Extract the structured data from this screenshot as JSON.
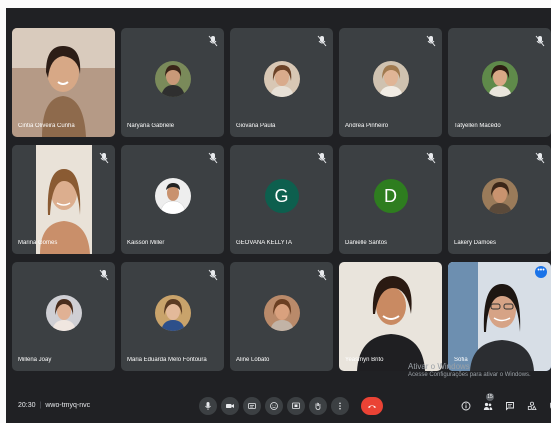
{
  "participants": [
    {
      "name": "Cintia Oliveira Cunha"
    },
    {
      "name": "Naryana Gabriele"
    },
    {
      "name": "Giovana Paula"
    },
    {
      "name": "Andrea Pinheiro"
    },
    {
      "name": "Tatyellen Macêdo"
    },
    {
      "name": "Marina Gomes"
    },
    {
      "name": "Kaisson Miller"
    },
    {
      "name": "GEOVANA KELLYTA",
      "initial": "G"
    },
    {
      "name": "Danielle Santos",
      "initial": "D"
    },
    {
      "name": "Lakery Damões"
    },
    {
      "name": "Millena Joay"
    },
    {
      "name": "Maria Eduarda Melo Fontoura"
    },
    {
      "name": "Aline Lobato"
    },
    {
      "name": "Yeasmyn Brito"
    },
    {
      "name": "Sofia"
    }
  ],
  "colors": {
    "screen_bg": "#202124",
    "tile_bg": "#3c4043",
    "letter_g": "#0d5f4e",
    "letter_d": "#2e7d1f",
    "hangup": "#ea4335",
    "highlight": "#8ab4f8"
  },
  "watermark": {
    "line1": "Ativar o Windows",
    "line2": "Acesse Configurações para ativar o Windows."
  },
  "meeting": {
    "time": "20:30",
    "code": "wwo-tmyq-nvc",
    "participant_count": "15"
  },
  "controls": [
    {
      "icon": "mic-icon"
    },
    {
      "icon": "camera-icon"
    },
    {
      "icon": "captions-icon"
    },
    {
      "icon": "emoji-icon"
    },
    {
      "icon": "present-icon"
    },
    {
      "icon": "raise-hand-icon"
    },
    {
      "icon": "more-options-icon"
    },
    {
      "icon": "hang-up-icon"
    }
  ],
  "right_controls": [
    {
      "icon": "info-icon"
    },
    {
      "icon": "people-icon"
    },
    {
      "icon": "chat-icon"
    },
    {
      "icon": "activities-icon"
    },
    {
      "icon": "host-controls-icon"
    }
  ]
}
